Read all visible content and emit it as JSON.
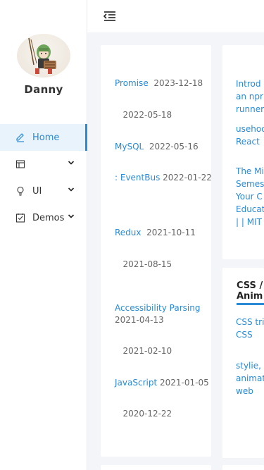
{
  "user": {
    "name": "Danny"
  },
  "header": {
    "glyph_col1": [
      "",
      ""
    ],
    "glyph_col2": [
      "",
      "",
      ""
    ],
    "glyph_col3": [
      "",
      ""
    ]
  },
  "nav": {
    "items": [
      {
        "label": "Home",
        "icon": "edit-icon",
        "active": true
      },
      {
        "label": "",
        "icon": "layout-icon",
        "expandable": true
      },
      {
        "label": "UI",
        "icon": "bulb-icon",
        "expandable": true
      },
      {
        "label": "Demos",
        "icon": "checklist-icon",
        "expandable": true
      }
    ]
  },
  "card1": {
    "title": "",
    "more": "",
    "posts": [
      {
        "title": "Promise",
        "date": "2023-12-18",
        "extra": ""
      },
      {
        "title": "",
        "date": "2022-05-18",
        "extra": ""
      },
      {
        "title": "MySQL",
        "date": "2022-05-16",
        "extra": ""
      },
      {
        "title": ": EventBus",
        "date": "2022-01-22",
        "extra": ""
      },
      {
        "title": "Redux",
        "date": "2021-10-11",
        "extra": ""
      },
      {
        "title": "",
        "date": "2021-08-15",
        "extra": ""
      },
      {
        "title": "Accessibility Parsing",
        "date": "2021-04-13",
        "extra": ""
      },
      {
        "title": "",
        "date": "2021-02-10",
        "extra": ""
      },
      {
        "title": "JavaScript",
        "date": "2021-01-05",
        "extra": ""
      },
      {
        "title": "",
        "date": "2020-12-22",
        "extra": ""
      }
    ]
  },
  "card2": {
    "title": "",
    "links": [
      "Introd an npr runner",
      "usehoo React",
      "The Mi Semes Your C Educat | | MIT"
    ]
  },
  "card3": {
    "title": "CSS / Anim",
    "links": [
      "CSS tri CSS",
      "stylie, animat web",
      "",
      ""
    ]
  },
  "colors": {
    "accent": "#2a8ad4",
    "active_bg": "#e8f3fb"
  }
}
